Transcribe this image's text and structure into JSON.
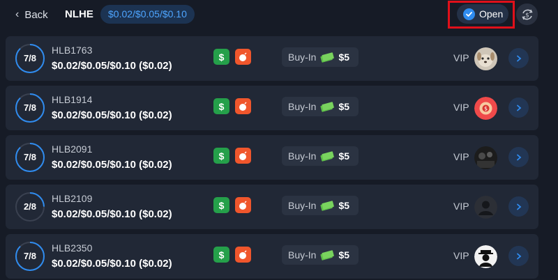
{
  "header": {
    "back_label": "Back",
    "game_type": "NLHE",
    "stakes_filter": "$0.02/$0.05/$0.10",
    "open_label": "Open"
  },
  "tables": [
    {
      "seats": "7/8",
      "name": "HLB1763",
      "stakes": "$0.02/$0.05/$0.10 ($0.02)",
      "buyin_label": "Buy-In",
      "buyin_amount": "$5",
      "vip_label": "VIP",
      "avatar": "dog-avatar"
    },
    {
      "seats": "7/8",
      "name": "HLB1914",
      "stakes": "$0.02/$0.05/$0.10 ($0.02)",
      "buyin_label": "Buy-In",
      "buyin_amount": "$5",
      "vip_label": "VIP",
      "avatar": "red-badge-avatar"
    },
    {
      "seats": "7/8",
      "name": "HLB2091",
      "stakes": "$0.02/$0.05/$0.10 ($0.02)",
      "buyin_label": "Buy-In",
      "buyin_amount": "$5",
      "vip_label": "VIP",
      "avatar": "dark-photo-avatar"
    },
    {
      "seats": "2/8",
      "name": "HLB2109",
      "stakes": "$0.02/$0.05/$0.10 ($0.02)",
      "buyin_label": "Buy-In",
      "buyin_amount": "$5",
      "vip_label": "VIP",
      "avatar": "default-user-avatar"
    },
    {
      "seats": "7/8",
      "name": "HLB2350",
      "stakes": "$0.02/$0.05/$0.10 ($0.02)",
      "buyin_label": "Buy-In",
      "buyin_amount": "$5",
      "vip_label": "VIP",
      "avatar": "hat-figure-avatar"
    }
  ],
  "colors": {
    "accent": "#2f8cf0",
    "highlight_box": "#e0101a",
    "dollar_badge": "#25a04a",
    "bomb_badge": "#f0562c"
  }
}
